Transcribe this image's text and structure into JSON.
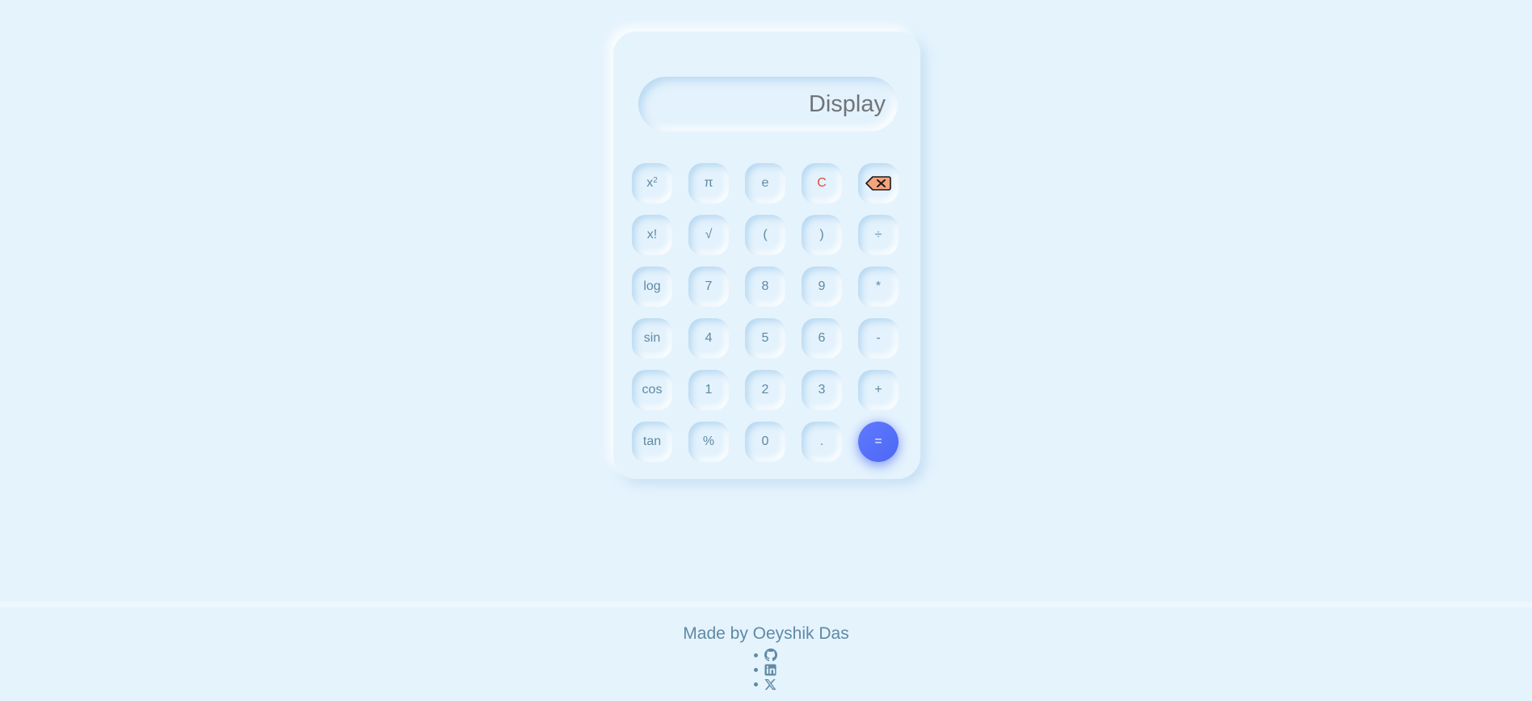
{
  "display": {
    "text": "Display"
  },
  "keys": {
    "square_base": "x",
    "square_exp": "2",
    "pi": "π",
    "e": "e",
    "clear": "C",
    "backspace_icon": "backspace-icon",
    "factorial": "x!",
    "sqrt": "√",
    "lparen": "(",
    "rparen": ")",
    "divide": "÷",
    "log": "log",
    "seven": "7",
    "eight": "8",
    "nine": "9",
    "multiply": "*",
    "sin": "sin",
    "four": "4",
    "five": "5",
    "six": "6",
    "minus": "-",
    "cos": "cos",
    "one": "1",
    "two": "2",
    "three": "3",
    "plus": "+",
    "tan": "tan",
    "percent": "%",
    "zero": "0",
    "dot": ".",
    "equals": "="
  },
  "footer": {
    "title": "Made by Oeyshik Das",
    "links": [
      "github-icon",
      "linkedin-icon",
      "x-twitter-icon"
    ]
  },
  "colors": {
    "background": "#e5f3fd",
    "key_text": "#5f8aa3",
    "clear_text": "#e24b3f",
    "equals_bg": "#5872f8",
    "display_text": "#6f7478"
  }
}
